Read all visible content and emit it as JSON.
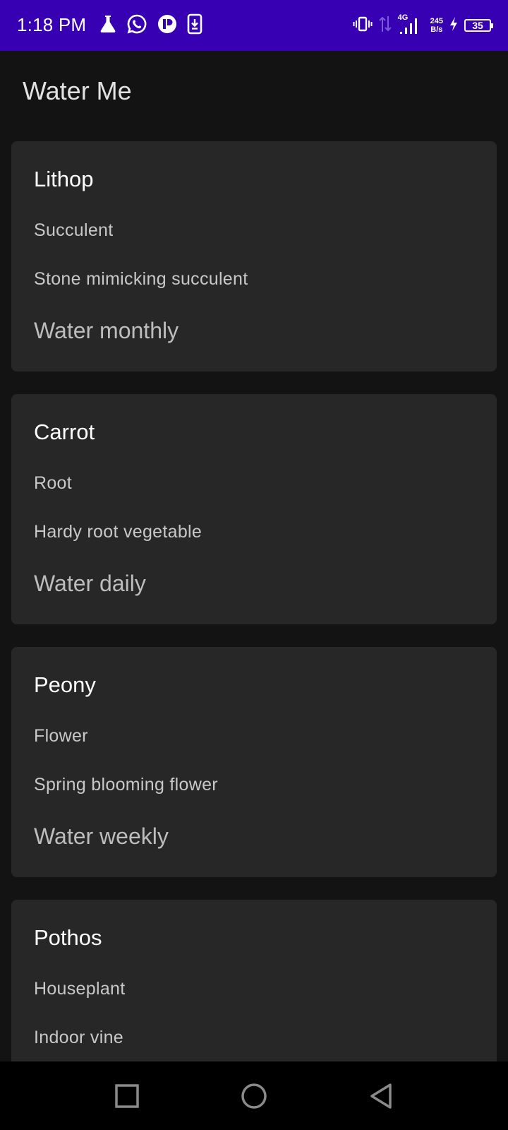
{
  "status_bar": {
    "time": "1:18 PM",
    "network_type": "4G",
    "net_speed_value": "245",
    "net_speed_unit": "B/s",
    "battery_level": "35",
    "background_color": "#3700b3",
    "left_icons": [
      "flask-icon",
      "whatsapp-icon",
      "app-p-icon",
      "download-icon"
    ],
    "right_icons": [
      "vibrate-icon",
      "data-arrows-icon",
      "signal-icon",
      "charging-bolt-icon",
      "battery-icon"
    ]
  },
  "app": {
    "title": "Water Me"
  },
  "plants": [
    {
      "name": "Lithop",
      "type": "Succulent",
      "description": "Stone mimicking succulent",
      "schedule": "Water monthly"
    },
    {
      "name": "Carrot",
      "type": "Root",
      "description": "Hardy root vegetable",
      "schedule": "Water daily"
    },
    {
      "name": "Peony",
      "type": "Flower",
      "description": "Spring blooming flower",
      "schedule": "Water weekly"
    },
    {
      "name": "Pothos",
      "type": "Houseplant",
      "description": "Indoor vine",
      "schedule": ""
    }
  ],
  "nav_bar": {
    "buttons": [
      "recents-square-icon",
      "home-circle-icon",
      "back-triangle-icon"
    ]
  }
}
